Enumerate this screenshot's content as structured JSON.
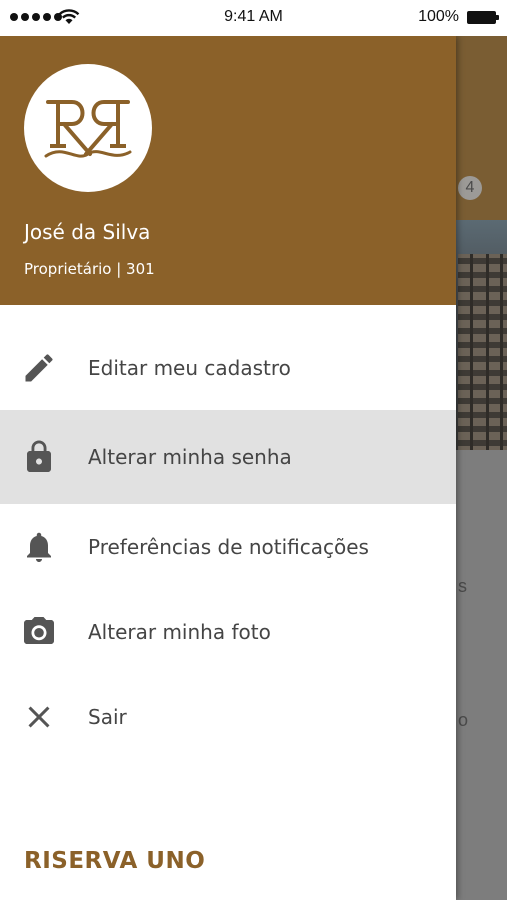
{
  "status_bar": {
    "time": "9:41 AM",
    "battery_percent": "100%",
    "signal_bars": 5
  },
  "background": {
    "badge_count": "4",
    "fragments": [
      "s",
      "o"
    ]
  },
  "drawer": {
    "user": {
      "name": "José da Silva",
      "role": "Proprietário | 301"
    },
    "logo": {
      "monogram": "RR"
    },
    "menu_items": [
      {
        "label": "Editar meu cadastro",
        "icon": "pencil-icon",
        "active": false
      },
      {
        "label": "Alterar minha senha",
        "icon": "lock-icon",
        "active": true
      },
      {
        "label": "Preferências de notificações",
        "icon": "bell-icon",
        "active": false
      },
      {
        "label": "Alterar minha foto",
        "icon": "camera-icon",
        "active": false
      },
      {
        "label": "Sair",
        "icon": "close-icon",
        "active": false
      }
    ],
    "brand": "RISERVA UNO"
  },
  "colors": {
    "header_brown": "#8b6129",
    "brand_text": "#8b6129",
    "menu_text": "#454545",
    "icon_gray": "#555555",
    "active_row": "#e1e1e1",
    "overlay_gray": "#7d7d7d"
  }
}
